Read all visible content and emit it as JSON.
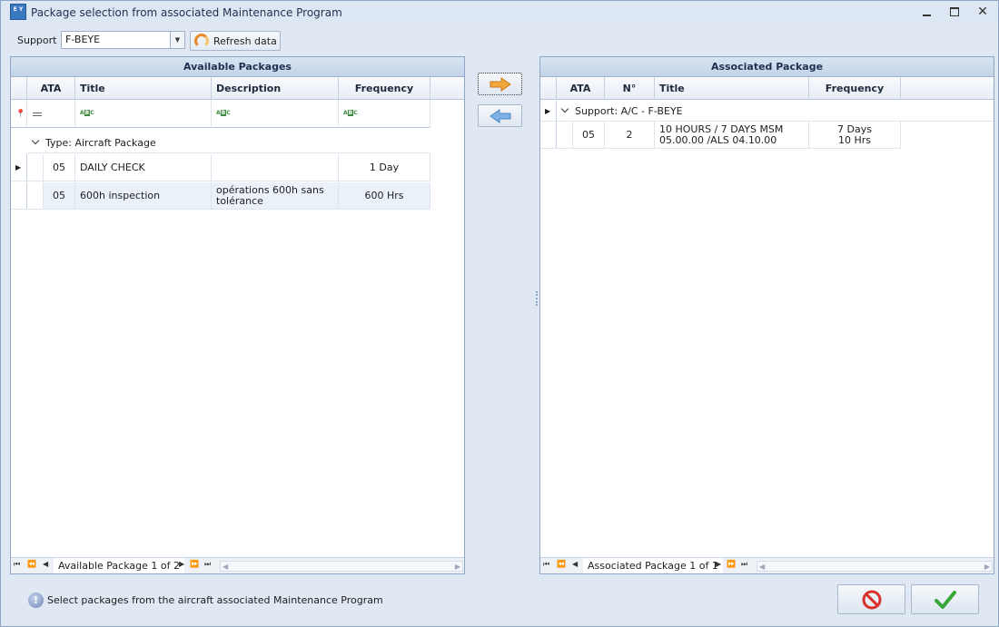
{
  "window": {
    "title": "Package selection from associated Maintenance Program",
    "icon_text": "E Y"
  },
  "support": {
    "label": "Support",
    "value": "F-BEYE",
    "refresh_label": "Refresh data"
  },
  "available": {
    "header": "Available Packages",
    "columns": [
      "ATA",
      "Title",
      "Description",
      "Frequency"
    ],
    "group_label": "Type: Aircraft Package",
    "rows": [
      {
        "ata": "05",
        "title": "DAILY CHECK",
        "description": "",
        "frequency": "1 Day"
      },
      {
        "ata": "05",
        "title": "600h inspection",
        "description_l1": "opérations 600h sans",
        "description_l2": "tolérance",
        "frequency": "600 Hrs"
      }
    ],
    "nav_label": "Available Package 1 of 2"
  },
  "associated": {
    "header": "Associated Package",
    "columns": [
      "ATA",
      "N°",
      "Title",
      "Frequency"
    ],
    "group_label": "Support: A/C - F-BEYE",
    "rows": [
      {
        "ata": "05",
        "number": "2",
        "title_l1": "10 HOURS / 7 DAYS MSM",
        "title_l2": "05.00.00 /ALS 04.10.00",
        "frequency_l1": "7 Days",
        "frequency_l2": "10 Hrs"
      }
    ],
    "nav_label": "Associated Package 1 of 1"
  },
  "footer": {
    "info_text": "Select packages from the aircraft associated Maintenance Program",
    "info_glyph": "!"
  },
  "colors": {
    "accent_arrow_right": "#f2a93b",
    "accent_arrow_left": "#7fb0e6",
    "cancel_red": "#d9302a",
    "ok_green": "#3aa63a"
  }
}
